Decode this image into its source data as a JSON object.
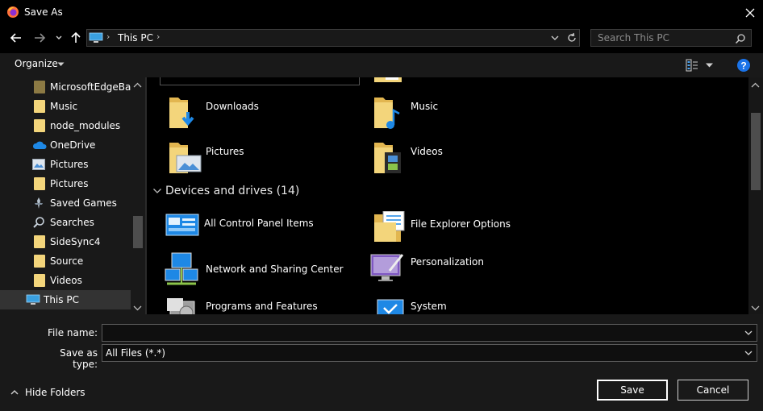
{
  "window": {
    "title": "Save As"
  },
  "nav": {
    "breadcrumb_root": "This PC",
    "search_placeholder": "Search This PC"
  },
  "toolbar": {
    "organize_label": "Organize"
  },
  "sidebar": {
    "items": [
      {
        "label": "MicrosoftEdgeBack",
        "icon": "folder-dark-icon"
      },
      {
        "label": "Music",
        "icon": "folder-icon"
      },
      {
        "label": "node_modules",
        "icon": "folder-icon"
      },
      {
        "label": "OneDrive",
        "icon": "cloud-icon"
      },
      {
        "label": "Pictures",
        "icon": "pictures-icon"
      },
      {
        "label": "Pictures",
        "icon": "folder-icon"
      },
      {
        "label": "Saved Games",
        "icon": "saved-games-icon"
      },
      {
        "label": "Searches",
        "icon": "search-icon"
      },
      {
        "label": "SideSync4",
        "icon": "folder-icon"
      },
      {
        "label": "Source",
        "icon": "folder-icon"
      },
      {
        "label": "Videos",
        "icon": "folder-icon"
      },
      {
        "label": "This PC",
        "icon": "computer-icon"
      }
    ]
  },
  "content": {
    "folders": [
      {
        "label": "Downloads",
        "icon": "downloads-folder-icon"
      },
      {
        "label": "Music",
        "icon": "music-folder-icon"
      },
      {
        "label": "Pictures",
        "icon": "pictures-folder-icon"
      },
      {
        "label": "Videos",
        "icon": "videos-folder-icon"
      }
    ],
    "group_header": "Devices and drives (14)",
    "devices": [
      {
        "label": "All Control Panel Items",
        "icon": "control-panel-icon"
      },
      {
        "label": "File Explorer Options",
        "icon": "file-explorer-options-icon"
      },
      {
        "label": "Network and Sharing Center",
        "icon": "network-icon"
      },
      {
        "label": "Personalization",
        "icon": "personalization-icon"
      },
      {
        "label": "Programs and Features",
        "icon": "programs-icon"
      },
      {
        "label": "System",
        "icon": "system-icon"
      }
    ]
  },
  "form": {
    "file_name_label": "File name:",
    "file_name_value": "",
    "save_type_label": "Save as type:",
    "save_type_value": "All Files (*.*)",
    "hide_folders_label": "Hide Folders",
    "save_label": "Save",
    "cancel_label": "Cancel"
  },
  "colors": {
    "background": "#000000",
    "panel": "#191919",
    "folder": "#f3d57b",
    "accent": "#1a73e8"
  }
}
